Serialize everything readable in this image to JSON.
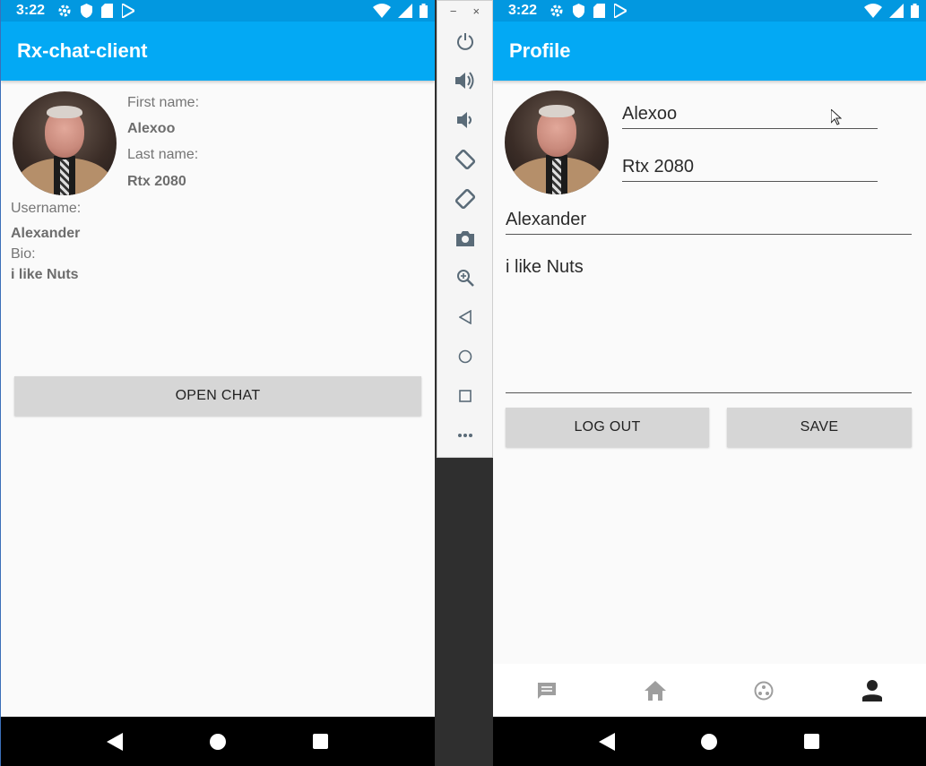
{
  "colors": {
    "primary": "#03a9f4",
    "primary_dark": "#0298e0",
    "button_bg": "#d6d6d6",
    "active_tab": "#222222",
    "inactive_tab": "#9e9e9e"
  },
  "status_bar": {
    "time": "3:22",
    "left_icons": [
      "settings-icon",
      "shield-icon",
      "sd-card-icon",
      "play-store-icon"
    ],
    "right_icons": [
      "wifi-icon",
      "signal-icon",
      "battery-icon"
    ]
  },
  "left_screen": {
    "app_title": "Rx-chat-client",
    "first_name_label": "First name:",
    "first_name_value": "Alexoo",
    "last_name_label": "Last name:",
    "last_name_value": "Rtx 2080",
    "username_label": "Username:",
    "username_value": "Alexander",
    "bio_label": "Bio:",
    "bio_value": "i like Nuts",
    "open_chat_label": "OPEN CHAT"
  },
  "right_screen": {
    "title": "Profile",
    "first_name_input": "Alexoo",
    "last_name_input": "Rtx 2080",
    "username_input": "Alexander",
    "bio_input": "i like Nuts",
    "logout_label": "LOG OUT",
    "save_label": "SAVE",
    "bottom_tabs": [
      {
        "icon": "chat-icon",
        "active": false
      },
      {
        "icon": "home-icon",
        "active": false
      },
      {
        "icon": "community-icon",
        "active": false
      },
      {
        "icon": "person-icon",
        "active": true
      }
    ]
  },
  "emulator_toolbar": {
    "window_controls": [
      "−",
      "×"
    ],
    "tools": [
      "power-icon",
      "volume-up-icon",
      "volume-down-icon",
      "rotate-left-icon",
      "rotate-right-icon",
      "camera-icon",
      "zoom-icon",
      "back-icon",
      "home-icon",
      "overview-icon",
      "more-icon"
    ]
  },
  "navigation_bar": [
    "back-icon",
    "home-icon",
    "recents-icon"
  ]
}
